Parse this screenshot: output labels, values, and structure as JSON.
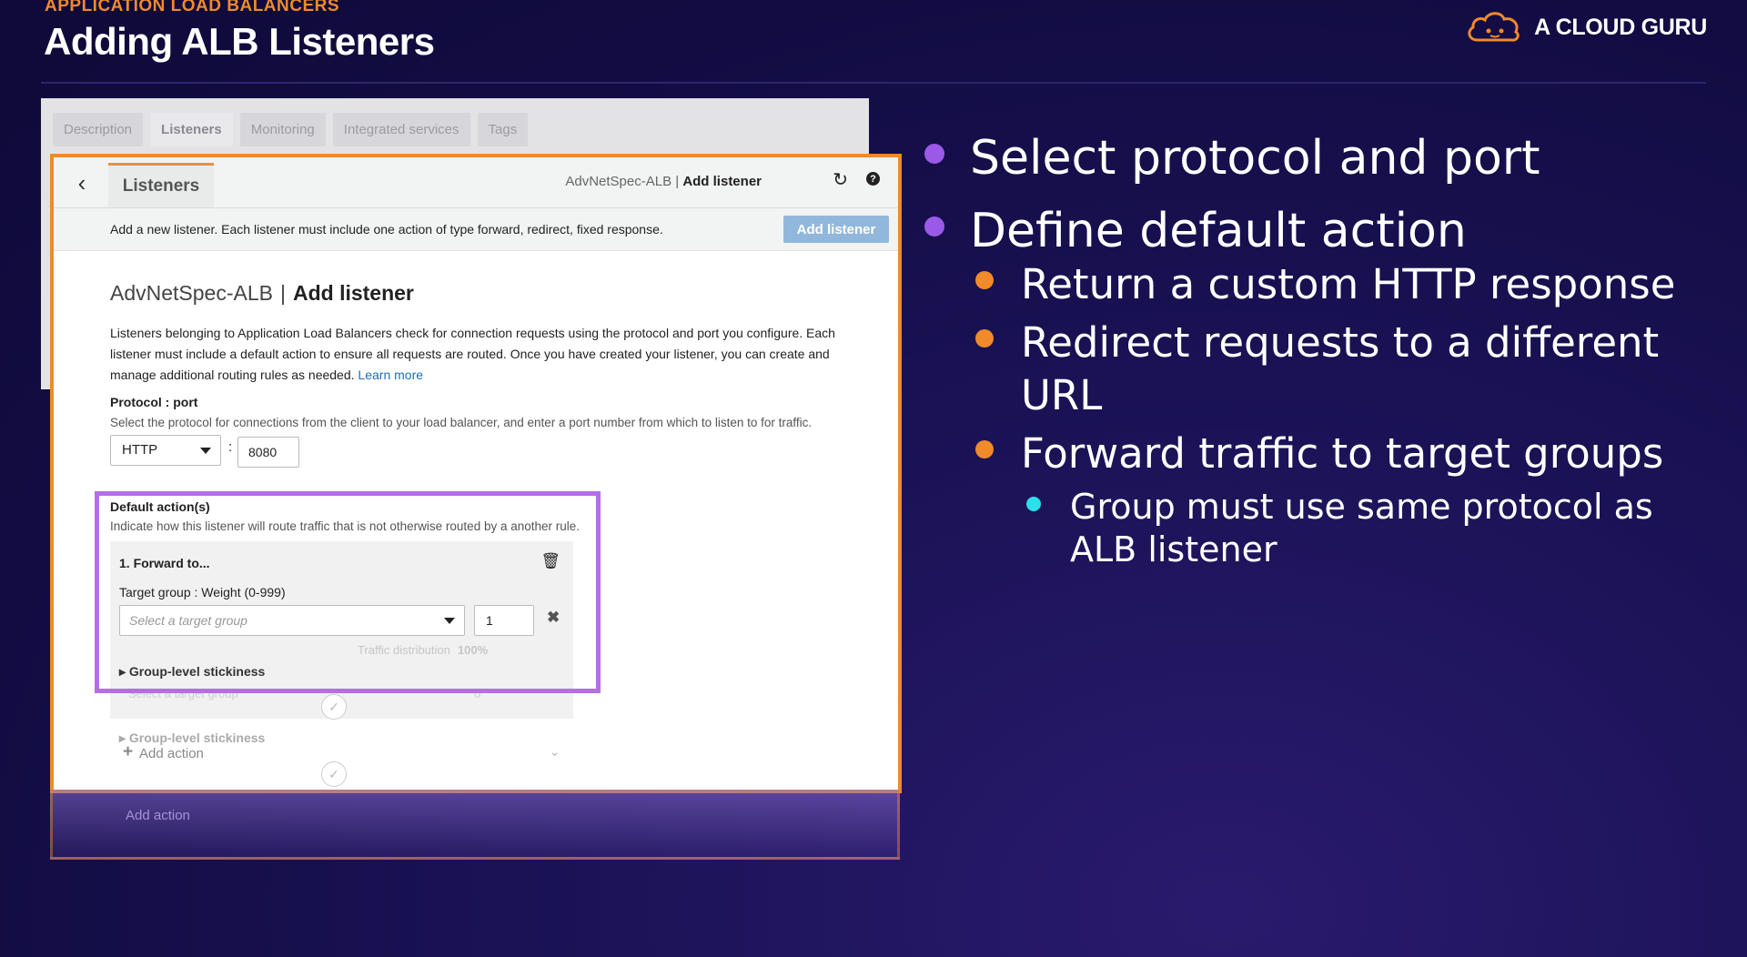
{
  "header": {
    "eyebrow": "APPLICATION LOAD BALANCERS",
    "title": "Adding ALB Listeners",
    "brand": "A CLOUD GURU"
  },
  "background_tabs": [
    "Description",
    "Listeners",
    "Monitoring",
    "Integrated services",
    "Tags"
  ],
  "console": {
    "back_tab": "Listeners",
    "crumb_name": "AdvNetSpec-ALB",
    "crumb_sep": " | ",
    "crumb_page": "Add listener",
    "info_bar": "Add a new listener. Each listener must include one action of type forward, redirect, fixed response.",
    "add_listener_button": "Add listener",
    "heading_name": "AdvNetSpec-ALB",
    "heading_sep": "|",
    "heading_page": "Add listener",
    "description": "Listeners belonging to Application Load Balancers check for connection requests using the protocol and port you configure. Each listener must include a default action to ensure all requests are routed. Once you have created your listener, you can create and manage additional routing rules as needed.",
    "learn_more": "Learn more",
    "protocol_label": "Protocol : port",
    "protocol_help": "Select the protocol for connections from the client to your load balancer, and enter a port number from which to listen to for traffic.",
    "protocol_value": "HTTP",
    "colon": ":",
    "port_value": "8080",
    "default_actions_label": "Default action(s)",
    "default_actions_help": "Indicate how this listener will route traffic that is not otherwise routed by a another rule.",
    "forward_title": "1. Forward to...",
    "target_group_label": "Target group : Weight (0-999)",
    "target_group_placeholder": "Select a target group",
    "weight_value": "1",
    "traffic_label": "Traffic distribution",
    "traffic_value": "100%",
    "stickiness_label": "Group-level stickiness",
    "ghost_target_placeholder": "Select a target group",
    "ghost_weight": "0",
    "ghost_stickiness": "Group-level stickiness",
    "add_action": "Add action"
  },
  "bullets": [
    {
      "level": 1,
      "text": "Select protocol and port"
    },
    {
      "level": 1,
      "text": "Define default action"
    },
    {
      "level": 2,
      "text": "Return a custom HTTP response"
    },
    {
      "level": 2,
      "text": "Redirect requests to a different URL"
    },
    {
      "level": 2,
      "text": "Forward traffic to target groups"
    },
    {
      "level": 3,
      "text": "Group must use same protocol as ALB listener"
    }
  ],
  "colors": {
    "background": "#140e48",
    "accent_orange": "#f08a2a",
    "highlight_purple": "#b46ee6",
    "bullet_purple": "#9b59e8",
    "bullet_cyan": "#2be0e8",
    "aws_button": "#91b8dc"
  },
  "icons": [
    "cloud-logo-icon",
    "back-arrow-icon",
    "refresh-icon",
    "help-icon",
    "dropdown-caret-icon",
    "trash-icon",
    "remove-icon",
    "expand-triangle-icon",
    "check-circle-icon",
    "plus-icon",
    "chevron-down-icon"
  ]
}
